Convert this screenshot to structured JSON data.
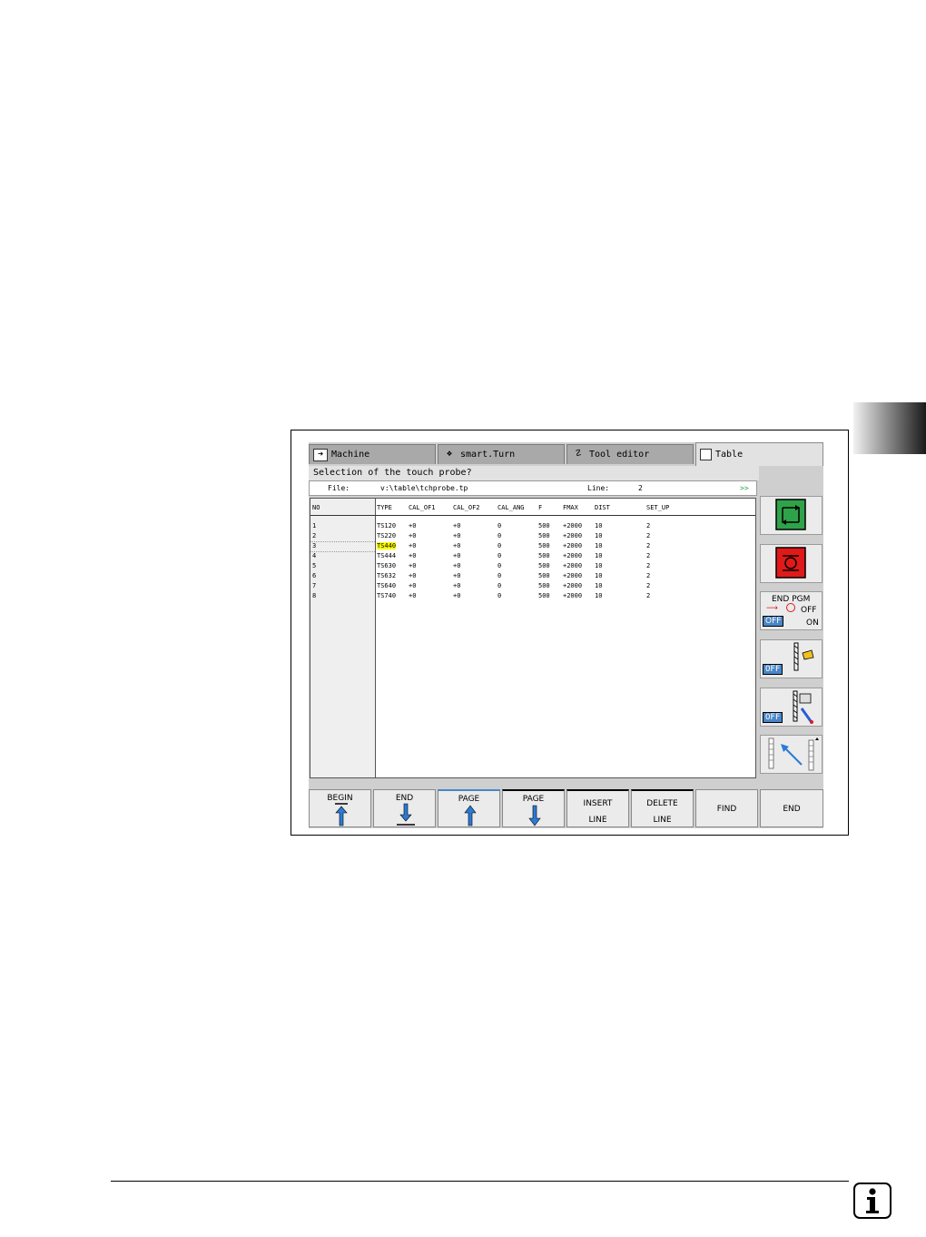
{
  "tabs": [
    {
      "label": "Machine",
      "icon": "arrow-right-icon"
    },
    {
      "label": "smart.Turn",
      "icon": "diamond-arrow-icon"
    },
    {
      "label": "Tool editor",
      "icon": "tool-icon"
    },
    {
      "label": "Table",
      "icon": "floppy-disk-icon"
    }
  ],
  "prompt": "Selection of the touch probe?",
  "file_bar": {
    "file_label": "File:",
    "file_path": "v:\\table\\tchprobe.tp",
    "line_label": "Line:",
    "line_value": "2",
    "more": ">>"
  },
  "table": {
    "no_header": "NO",
    "headers": [
      "TYPE",
      "CAL_OF1",
      "CAL_OF2",
      "CAL_ANG",
      "F",
      "FMAX",
      "DIST",
      "SET_UP"
    ],
    "rows": [
      {
        "no": "1",
        "cells": [
          "TS120",
          "+0",
          "+0",
          "0",
          "500",
          "+2000",
          "10",
          "2"
        ]
      },
      {
        "no": "2",
        "cells": [
          "TS220",
          "+0",
          "+0",
          "0",
          "500",
          "+2000",
          "10",
          "2"
        ]
      },
      {
        "no": "3",
        "cells": [
          "TS440",
          "+0",
          "+0",
          "0",
          "500",
          "+2000",
          "10",
          "2"
        ]
      },
      {
        "no": "4",
        "cells": [
          "TS444",
          "+0",
          "+0",
          "0",
          "500",
          "+2000",
          "10",
          "2"
        ]
      },
      {
        "no": "5",
        "cells": [
          "TS630",
          "+0",
          "+0",
          "0",
          "500",
          "+2000",
          "10",
          "2"
        ]
      },
      {
        "no": "6",
        "cells": [
          "TS632",
          "+0",
          "+0",
          "0",
          "500",
          "+2000",
          "10",
          "2"
        ]
      },
      {
        "no": "7",
        "cells": [
          "TS640",
          "+0",
          "+0",
          "0",
          "500",
          "+2000",
          "10",
          "2"
        ]
      },
      {
        "no": "8",
        "cells": [
          "TS740",
          "+0",
          "+0",
          "0",
          "500",
          "+2000",
          "10",
          "2"
        ]
      }
    ],
    "selected_row": 2
  },
  "right_keys": {
    "end_pgm_line1": "END PGM",
    "end_pgm_off": "OFF",
    "end_pgm_on": "ON",
    "off_label": "OFF"
  },
  "bottom_keys": {
    "begin": "BEGIN",
    "end_down": "END",
    "page_up": "PAGE",
    "page_down": "PAGE",
    "insert_1": "INSERT",
    "insert_2": "LINE",
    "delete_1": "DELETE",
    "delete_2": "LINE",
    "find": "FIND",
    "end": "END"
  },
  "colors": {
    "highlight": "#ffff00",
    "green_key": "#2fa34a",
    "red_key": "#e01919",
    "off_tag": "#4a86c8",
    "arrow_blue": "#2b7bd6"
  }
}
